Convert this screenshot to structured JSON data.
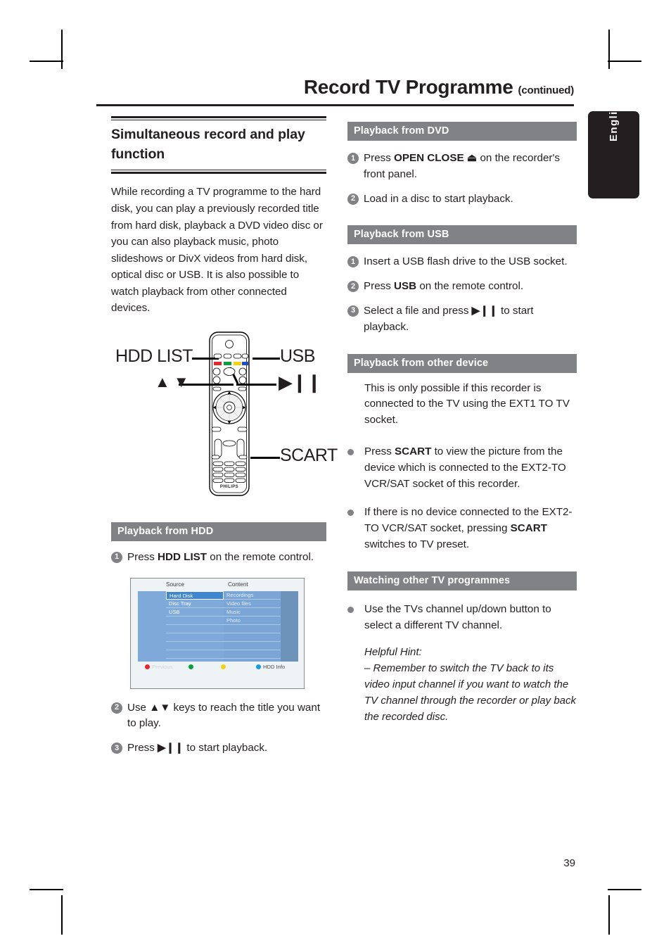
{
  "header": {
    "title": "Record TV Programme",
    "continued": "(continued)"
  },
  "side_tab": {
    "label": "English"
  },
  "page_number": "39",
  "left_column": {
    "section_heading": "Simultaneous record and play function",
    "intro": "While recording a TV programme to the hard disk, you can play a previously recorded title from hard disk, playback a DVD video disc or you can also playback music, photo slideshows or DivX videos from hard disk, optical disc or USB.  It is also possible to watch playback from other connected devices.",
    "remote_callouts": {
      "hdd_list": "HDD LIST",
      "usb": "USB",
      "updown": "▲ ▼",
      "playpause": "▶❘❘",
      "scart": "SCART",
      "brand": "PHILIPS"
    },
    "hdd_section": {
      "bar": "Playback from HDD",
      "step1_pre": "Press ",
      "step1_bold": "HDD LIST",
      "step1_post": " on the remote control.",
      "step2_pre": "Use ",
      "step2_keys": "▲▼",
      "step2_post": " keys to reach the title you want to play.",
      "step3_pre": "Press ",
      "step3_icon": "▶❘❘",
      "step3_post": " to start playback."
    },
    "hdd_screen": {
      "header_source": "Source",
      "header_content": "Content",
      "sources": [
        "Hard Disk",
        "Disc Tray",
        "USB"
      ],
      "contents": [
        "Recordings",
        "Video files",
        "Music",
        "Photo"
      ],
      "selected_source": "Hard Disk",
      "footer": [
        {
          "color": "#e8262a",
          "label": "Previous",
          "ghost": true
        },
        {
          "color": "#0a9f3c",
          "label": "",
          "ghost": false
        },
        {
          "color": "#f5d20b",
          "label": "",
          "ghost": false
        },
        {
          "color": "#1b9ae0",
          "label": "HDD Info",
          "ghost": false
        }
      ]
    }
  },
  "right_column": {
    "dvd": {
      "bar": "Playback from DVD",
      "step1_pre": "Press ",
      "step1_bold": "OPEN CLOSE",
      "step1_icon": "⏏",
      "step1_post": " on the recorder's front panel.",
      "step2": "Load in a disc to start playback."
    },
    "usb": {
      "bar": "Playback from USB",
      "step1": "Insert a USB flash drive to the USB socket.",
      "step2_pre": "Press ",
      "step2_bold": "USB",
      "step2_post": " on the remote control.",
      "step3_pre": "Select a file and press ",
      "step3_icon": "▶❘❘",
      "step3_post": " to start playback."
    },
    "other_device": {
      "bar": "Playback from other device",
      "intro": "This is only possible if this recorder is connected to the TV using the EXT1 TO TV socket.",
      "bullet1_pre": "Press ",
      "bullet1_bold": "SCART",
      "bullet1_post": " to view the picture from the device which is connected to the EXT2-TO VCR/SAT socket of this recorder.",
      "bullet2_pre": "If there is no device connected to the EXT2-TO VCR/SAT socket, pressing ",
      "bullet2_bold": "SCART",
      "bullet2_post": " switches to TV preset."
    },
    "watching": {
      "bar": "Watching other TV programmes",
      "bullet1": "Use the TVs channel up/down button to select a different TV channel.",
      "hint_title": "Helpful Hint:",
      "hint_body": "– Remember to switch the TV back to its video input channel if you want to watch the TV channel through the recorder or play back the recorded disc."
    }
  }
}
